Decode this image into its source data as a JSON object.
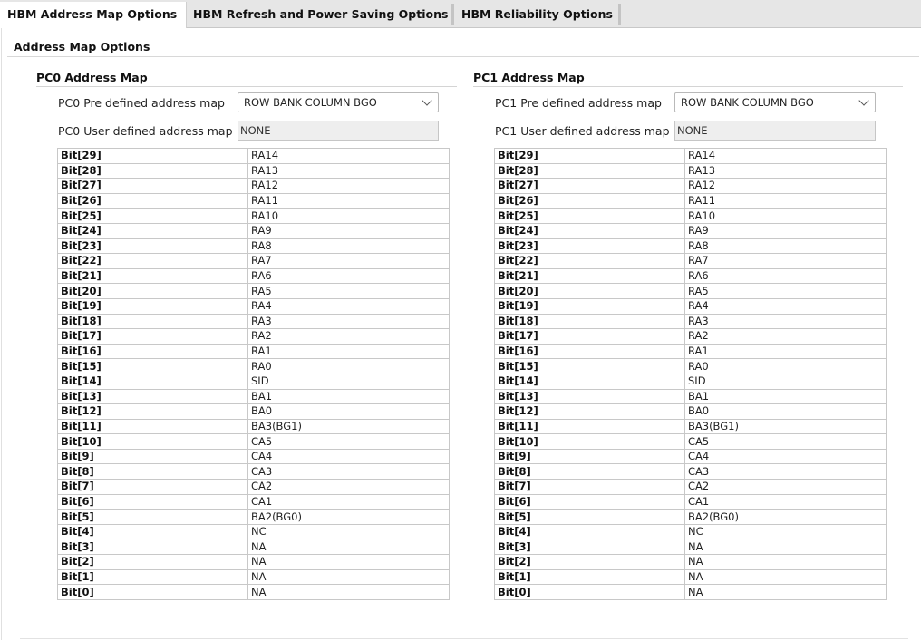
{
  "tabs": [
    {
      "label": "HBM Address Map Options",
      "active": true
    },
    {
      "label": "HBM Refresh and Power Saving Options",
      "active": false
    },
    {
      "label": "HBM Reliability Options",
      "active": false
    }
  ],
  "section_title": "Address Map Options",
  "pc0": {
    "title": "PC0 Address Map",
    "predefined_label": "PC0 Pre defined address map",
    "predefined_value": "ROW BANK COLUMN BGO",
    "userdefined_label": "PC0 User defined address map",
    "userdefined_value": "NONE"
  },
  "pc1": {
    "title": "PC1 Address Map",
    "predefined_label": "PC1 Pre defined address map",
    "predefined_value": "ROW BANK COLUMN BGO",
    "userdefined_label": "PC1 User defined address map",
    "userdefined_value": "NONE"
  },
  "map_rows": [
    {
      "bit": "Bit[29]",
      "value": "RA14"
    },
    {
      "bit": "Bit[28]",
      "value": "RA13"
    },
    {
      "bit": "Bit[27]",
      "value": "RA12"
    },
    {
      "bit": "Bit[26]",
      "value": "RA11"
    },
    {
      "bit": "Bit[25]",
      "value": "RA10"
    },
    {
      "bit": "Bit[24]",
      "value": "RA9"
    },
    {
      "bit": "Bit[23]",
      "value": "RA8"
    },
    {
      "bit": "Bit[22]",
      "value": "RA7"
    },
    {
      "bit": "Bit[21]",
      "value": "RA6"
    },
    {
      "bit": "Bit[20]",
      "value": "RA5"
    },
    {
      "bit": "Bit[19]",
      "value": "RA4"
    },
    {
      "bit": "Bit[18]",
      "value": "RA3"
    },
    {
      "bit": "Bit[17]",
      "value": "RA2"
    },
    {
      "bit": "Bit[16]",
      "value": "RA1"
    },
    {
      "bit": "Bit[15]",
      "value": "RA0"
    },
    {
      "bit": "Bit[14]",
      "value": "SID"
    },
    {
      "bit": "Bit[13]",
      "value": "BA1"
    },
    {
      "bit": "Bit[12]",
      "value": "BA0"
    },
    {
      "bit": "Bit[11]",
      "value": "BA3(BG1)"
    },
    {
      "bit": "Bit[10]",
      "value": "CA5"
    },
    {
      "bit": "Bit[9]",
      "value": "CA4"
    },
    {
      "bit": "Bit[8]",
      "value": "CA3"
    },
    {
      "bit": "Bit[7]",
      "value": "CA2"
    },
    {
      "bit": "Bit[6]",
      "value": "CA1"
    },
    {
      "bit": "Bit[5]",
      "value": "BA2(BG0)"
    },
    {
      "bit": "Bit[4]",
      "value": "NC"
    },
    {
      "bit": "Bit[3]",
      "value": "NA"
    },
    {
      "bit": "Bit[2]",
      "value": "NA"
    },
    {
      "bit": "Bit[1]",
      "value": "NA"
    },
    {
      "bit": "Bit[0]",
      "value": "NA"
    }
  ]
}
